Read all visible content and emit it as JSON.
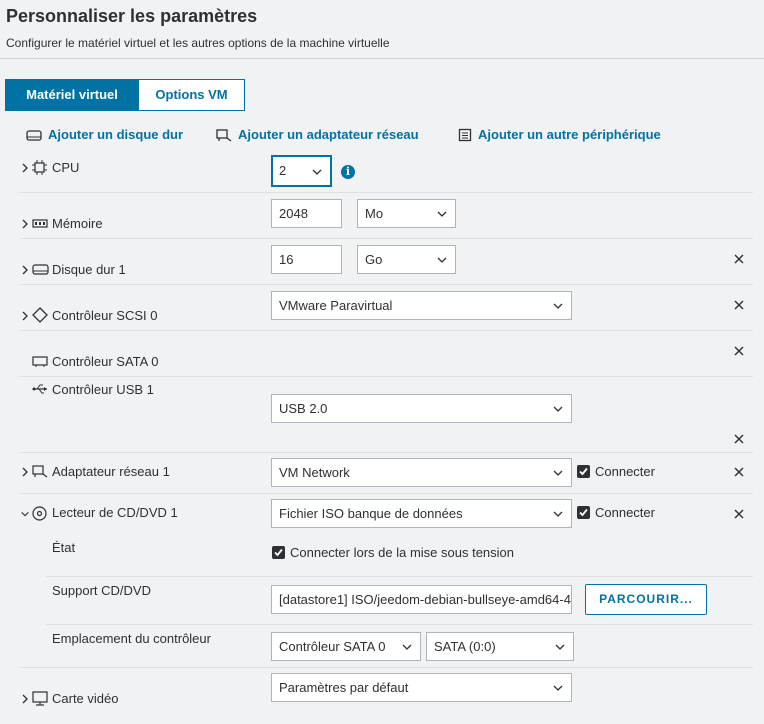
{
  "header": {
    "title": "Personnaliser les paramètres",
    "subtitle": "Configurer le matériel virtuel et les autres options de la machine virtuelle"
  },
  "tabs": [
    {
      "label": "Matériel virtuel",
      "active": true
    },
    {
      "label": "Options VM",
      "active": false
    }
  ],
  "actions": {
    "add_disk": "Ajouter un disque dur",
    "add_network": "Ajouter un adaptateur réseau",
    "add_other": "Ajouter un autre périphérique"
  },
  "rows": {
    "cpu": {
      "label": "CPU",
      "value": "2"
    },
    "memory": {
      "label": "Mémoire",
      "value": "2048",
      "unit": "Mo"
    },
    "disk": {
      "label": "Disque dur 1",
      "value": "16",
      "unit": "Go"
    },
    "scsi": {
      "label": "Contrôleur SCSI 0",
      "value": "VMware Paravirtual"
    },
    "sata": {
      "label": "Contrôleur SATA 0"
    },
    "usb": {
      "label": "Contrôleur USB 1",
      "value": "USB 2.0"
    },
    "network": {
      "label": "Adaptateur réseau 1",
      "value": "VM Network",
      "connect": "Connecter"
    },
    "cdrom": {
      "label": "Lecteur de CD/DVD 1",
      "value": "Fichier ISO banque de données",
      "connect": "Connecter",
      "state_label": "État",
      "state_value": "Connecter lors de la mise sous tension",
      "media_label": "Support CD/DVD",
      "media_value": "[datastore1] ISO/jeedom-debian-bullseye-amd64-4",
      "browse": "PARCOURIR...",
      "controller_label": "Emplacement du contrôleur",
      "controller_value": "Contrôleur SATA 0",
      "slot_value": "SATA (0:0)"
    },
    "video": {
      "label": "Carte vidéo",
      "value": "Paramètres par défaut"
    }
  },
  "colors": {
    "accent": "#0072a3",
    "background": "#f1f2f4"
  }
}
